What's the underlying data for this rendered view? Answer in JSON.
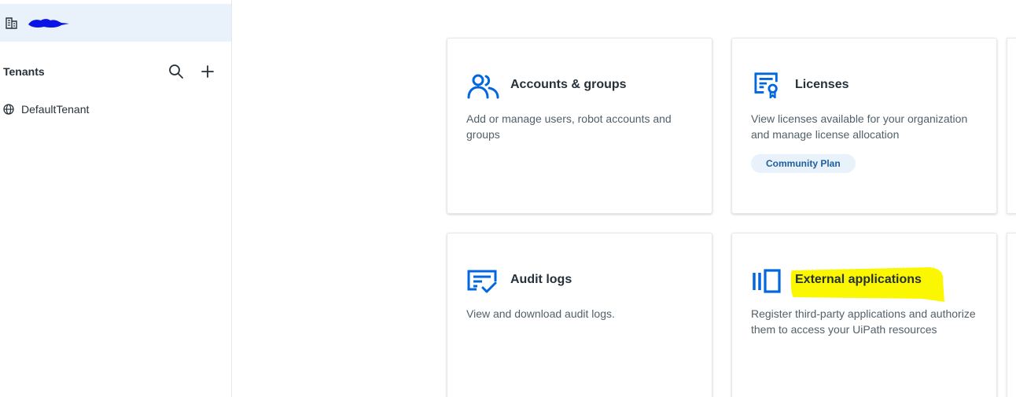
{
  "sidebar": {
    "org_icon": "building-icon",
    "tenants_label": "Tenants",
    "search_icon": "search-icon",
    "add_icon": "plus-icon",
    "tenants": [
      {
        "label": "DefaultTenant",
        "icon": "globe-icon"
      }
    ]
  },
  "cards": [
    {
      "title": "Accounts & groups",
      "description": "Add or manage users, robot accounts and groups",
      "icon": "users-icon"
    },
    {
      "title": "Licenses",
      "description": "View licenses available for your organization and manage license allocation",
      "icon": "license-icon",
      "badge": "Community Plan"
    },
    {
      "title": "Audit logs",
      "description": "View and download audit logs.",
      "icon": "audit-log-icon"
    },
    {
      "title": "External applications",
      "description": "Register third-party applications and authorize them to access your UiPath resources",
      "icon": "external-apps-icon"
    }
  ],
  "colors": {
    "accent": "#0067df",
    "highlight": "#fbf700",
    "badge_bg": "#e9f1fa",
    "redaction": "#0a14e6"
  }
}
